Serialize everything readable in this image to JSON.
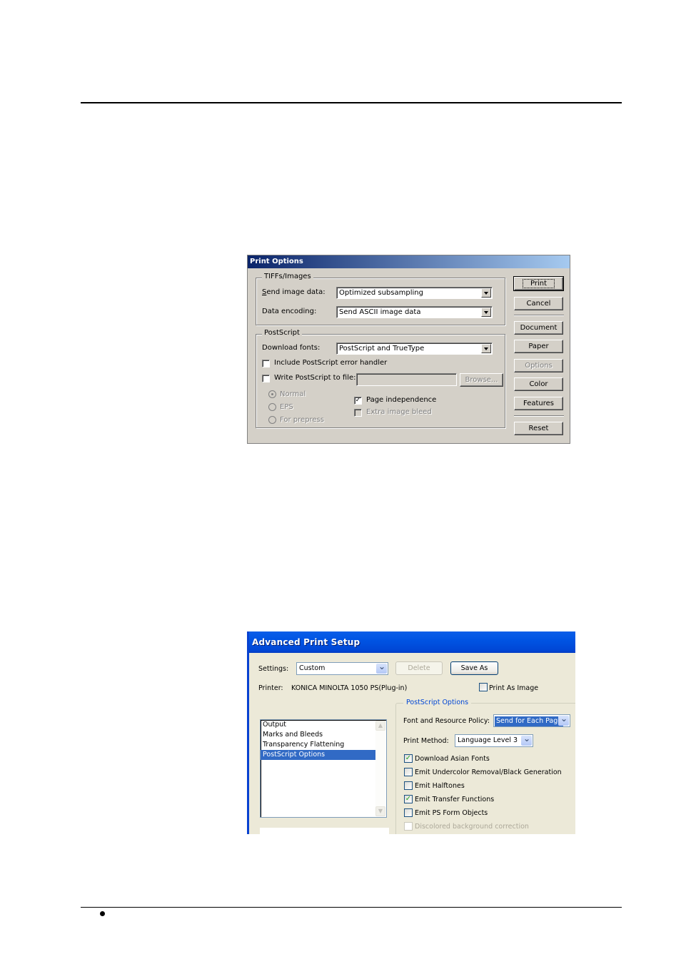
{
  "page": {
    "footer_bullet": "•"
  },
  "print_options": {
    "title": "Print Options",
    "tiffs_group": {
      "label": "TIFFs/Images",
      "send_image_data_label": "Send image data:",
      "send_image_data_value": "Optimized subsampling",
      "data_encoding_label": "Data encoding:",
      "data_encoding_value": "Send ASCII image data"
    },
    "postscript_group": {
      "label": "PostScript",
      "download_fonts_label": "Download fonts:",
      "download_fonts_value": "PostScript and TrueType",
      "include_error_handler": {
        "label": "Include PostScript error handler",
        "checked": false
      },
      "write_to_file": {
        "label": "Write PostScript to file:",
        "checked": false,
        "path": ""
      },
      "browse_label": "Browse...",
      "radios": [
        {
          "label": "Normal",
          "selected": true,
          "disabled": true
        },
        {
          "label": "EPS",
          "selected": false,
          "disabled": true
        },
        {
          "label": "For prepress",
          "selected": false,
          "disabled": true
        }
      ],
      "page_independence": {
        "label": "Page independence",
        "checked": true
      },
      "extra_image_bleed": {
        "label": "Extra image bleed",
        "checked": false,
        "disabled": true
      }
    },
    "buttons": {
      "print": "Print",
      "cancel": "Cancel",
      "document": "Document",
      "paper": "Paper",
      "options": "Options",
      "color": "Color",
      "features": "Features",
      "reset": "Reset"
    }
  },
  "advanced_print_setup": {
    "title": "Advanced Print Setup",
    "settings_label": "Settings:",
    "settings_value": "Custom",
    "delete_label": "Delete",
    "save_as_label": "Save As",
    "printer_label": "Printer:",
    "printer_value": "KONICA MINOLTA 1050 PS(Plug-in)",
    "print_as_image": {
      "label": "Print As Image",
      "checked": false
    },
    "nav_list": [
      {
        "label": "Output",
        "selected": false
      },
      {
        "label": "Marks and Bleeds",
        "selected": false
      },
      {
        "label": "Transparency Flattening",
        "selected": false
      },
      {
        "label": "PostScript Options",
        "selected": true
      }
    ],
    "postscript_options": {
      "group_label": "PostScript Options",
      "font_policy_label": "Font and Resource Policy:",
      "font_policy_value": "Send for Each Page",
      "print_method_label": "Print Method:",
      "print_method_value": "Language Level 3",
      "checkboxes": [
        {
          "label": "Download Asian Fonts",
          "checked": true,
          "disabled": false
        },
        {
          "label": "Emit Undercolor Removal/Black Generation",
          "checked": false,
          "disabled": false
        },
        {
          "label": "Emit Halftones",
          "checked": false,
          "disabled": false
        },
        {
          "label": "Emit Transfer Functions",
          "checked": true,
          "disabled": false
        },
        {
          "label": "Emit PS Form Objects",
          "checked": false,
          "disabled": false
        },
        {
          "label": "Discolored background correction",
          "checked": false,
          "disabled": true
        }
      ]
    }
  }
}
